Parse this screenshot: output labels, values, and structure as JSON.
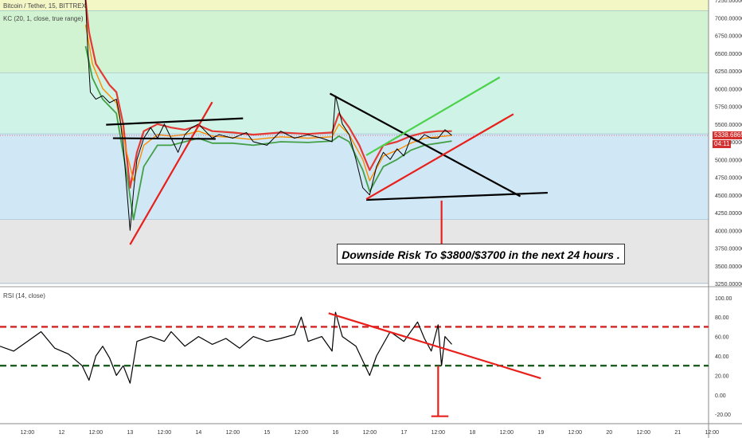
{
  "header": {
    "symbol_line": "Bitcoin / Tether, 15, BITTREX",
    "indicator_line": "KC (20, 1, close, true range)",
    "rsi_line": "RSI (14, close)"
  },
  "current_price_label": "5338.68652",
  "countdown_label": "04:11",
  "annotation": "Downside Risk To  $3800/$3700 in the next 24 hours .",
  "colors": {
    "price_line": "#000000",
    "kc_red": "#e53935",
    "kc_orange": "#fb8c00",
    "kc_green": "#43a047",
    "trend_red": "#e8201c",
    "trend_green": "#4cd14c",
    "rsi_overbought": "#d32f2f",
    "rsi_oversold": "#1b5e20"
  },
  "chart_data": [
    {
      "type": "line",
      "title": "Bitcoin / Tether, 15, BITTREX",
      "ylim": [
        3250,
        7250
      ],
      "y_ticks": [
        "7250.00000",
        "7000.00000",
        "6750.00000",
        "6500.00000",
        "6250.00000",
        "6000.00000",
        "5750.00000",
        "5500.00000",
        "5250.00000",
        "5000.00000",
        "4750.00000",
        "4500.00000",
        "4250.00000",
        "4000.00000",
        "3750.00000",
        "3500.00000",
        "3250.00000"
      ],
      "x_ticks": [
        "12:00",
        "12",
        "12:00",
        "13",
        "12:00",
        "14",
        "12:00",
        "15",
        "12:00",
        "16",
        "12:00",
        "17",
        "12:00",
        "18",
        "12:00",
        "19",
        "12:00",
        "20",
        "12:00",
        "21",
        "12:00"
      ],
      "x_tick_pos": [
        0.5,
        1,
        1.5,
        2,
        2.5,
        3,
        3.5,
        4,
        4.5,
        5,
        5.5,
        6,
        6.5,
        7,
        7.5,
        8,
        8.5,
        9,
        9.5,
        10,
        10.5
      ],
      "xlim": [
        0.1,
        10.45
      ],
      "zones": [
        {
          "from": 7100,
          "to": 7250,
          "color": "#f3f7c6"
        },
        {
          "from": 6220,
          "to": 7100,
          "color": "#d2f3d2"
        },
        {
          "from": 5360,
          "to": 6220,
          "color": "#cff3e6"
        },
        {
          "from": 4150,
          "to": 5360,
          "color": "#d0e8f5"
        },
        {
          "from": 3250,
          "to": 4150,
          "color": "#e6e6e6"
        }
      ],
      "series": [
        {
          "type": "price",
          "values": [
            [
              1.35,
              7250
            ],
            [
              1.38,
              6600
            ],
            [
              1.42,
              5950
            ],
            [
              1.5,
              5850
            ],
            [
              1.6,
              5900
            ],
            [
              1.7,
              5800
            ],
            [
              1.8,
              5850
            ],
            [
              1.85,
              5600
            ],
            [
              1.9,
              5200
            ],
            [
              1.95,
              4600
            ],
            [
              2.0,
              4000
            ],
            [
              2.05,
              4550
            ],
            [
              2.1,
              5000
            ],
            [
              2.2,
              5300
            ],
            [
              2.3,
              5450
            ],
            [
              2.4,
              5300
            ],
            [
              2.5,
              5500
            ],
            [
              2.6,
              5300
            ],
            [
              2.7,
              5100
            ],
            [
              2.8,
              5350
            ],
            [
              2.9,
              5450
            ],
            [
              3.0,
              5500
            ],
            [
              3.1,
              5400
            ],
            [
              3.2,
              5300
            ],
            [
              3.3,
              5350
            ],
            [
              3.5,
              5300
            ],
            [
              3.7,
              5380
            ],
            [
              3.8,
              5250
            ],
            [
              4.0,
              5200
            ],
            [
              4.2,
              5400
            ],
            [
              4.4,
              5300
            ],
            [
              4.6,
              5350
            ],
            [
              4.8,
              5300
            ],
            [
              4.95,
              5250
            ],
            [
              5.0,
              5900
            ],
            [
              5.1,
              5500
            ],
            [
              5.2,
              5350
            ],
            [
              5.3,
              5000
            ],
            [
              5.4,
              4600
            ],
            [
              5.5,
              4500
            ],
            [
              5.6,
              4900
            ],
            [
              5.7,
              5100
            ],
            [
              5.8,
              5000
            ],
            [
              5.9,
              5150
            ],
            [
              6.0,
              5050
            ],
            [
              6.1,
              5300
            ],
            [
              6.2,
              5250
            ],
            [
              6.3,
              5350
            ],
            [
              6.4,
              5300
            ],
            [
              6.5,
              5300
            ],
            [
              6.6,
              5420
            ],
            [
              6.7,
              5340
            ]
          ]
        },
        {
          "type": "kc_red",
          "values": [
            [
              1.35,
              7250
            ],
            [
              1.4,
              6800
            ],
            [
              1.5,
              6350
            ],
            [
              1.6,
              6200
            ],
            [
              1.7,
              6050
            ],
            [
              1.8,
              5950
            ],
            [
              1.9,
              5500
            ],
            [
              2.0,
              4600
            ],
            [
              2.1,
              5100
            ],
            [
              2.2,
              5400
            ],
            [
              2.4,
              5500
            ],
            [
              2.6,
              5450
            ],
            [
              2.8,
              5420
            ],
            [
              3.0,
              5480
            ],
            [
              3.2,
              5400
            ],
            [
              3.5,
              5380
            ],
            [
              3.8,
              5350
            ],
            [
              4.2,
              5380
            ],
            [
              4.6,
              5360
            ],
            [
              4.95,
              5380
            ],
            [
              5.05,
              5650
            ],
            [
              5.2,
              5450
            ],
            [
              5.35,
              5200
            ],
            [
              5.5,
              4850
            ],
            [
              5.7,
              5200
            ],
            [
              5.9,
              5250
            ],
            [
              6.1,
              5330
            ],
            [
              6.3,
              5380
            ],
            [
              6.5,
              5400
            ],
            [
              6.7,
              5400
            ]
          ]
        },
        {
          "type": "kc_orange",
          "values": [
            [
              1.35,
              6900
            ],
            [
              1.45,
              6350
            ],
            [
              1.6,
              6000
            ],
            [
              1.8,
              5800
            ],
            [
              1.95,
              5100
            ],
            [
              2.05,
              4700
            ],
            [
              2.2,
              5200
            ],
            [
              2.4,
              5350
            ],
            [
              2.6,
              5330
            ],
            [
              2.8,
              5350
            ],
            [
              3.0,
              5400
            ],
            [
              3.2,
              5330
            ],
            [
              3.5,
              5310
            ],
            [
              3.8,
              5280
            ],
            [
              4.2,
              5320
            ],
            [
              4.6,
              5300
            ],
            [
              4.95,
              5320
            ],
            [
              5.05,
              5500
            ],
            [
              5.2,
              5350
            ],
            [
              5.4,
              5000
            ],
            [
              5.5,
              4700
            ],
            [
              5.7,
              5050
            ],
            [
              5.9,
              5130
            ],
            [
              6.1,
              5230
            ],
            [
              6.3,
              5300
            ],
            [
              6.5,
              5320
            ],
            [
              6.7,
              5340
            ]
          ]
        },
        {
          "type": "kc_green",
          "values": [
            [
              1.35,
              6600
            ],
            [
              1.45,
              6150
            ],
            [
              1.6,
              5850
            ],
            [
              1.8,
              5650
            ],
            [
              1.95,
              4800
            ],
            [
              2.05,
              4150
            ],
            [
              2.2,
              4900
            ],
            [
              2.4,
              5200
            ],
            [
              2.6,
              5200
            ],
            [
              2.8,
              5250
            ],
            [
              3.0,
              5300
            ],
            [
              3.2,
              5230
            ],
            [
              3.5,
              5230
            ],
            [
              3.8,
              5200
            ],
            [
              4.2,
              5250
            ],
            [
              4.6,
              5240
            ],
            [
              4.95,
              5260
            ],
            [
              5.05,
              5330
            ],
            [
              5.2,
              5250
            ],
            [
              5.4,
              4850
            ],
            [
              5.5,
              4550
            ],
            [
              5.7,
              4900
            ],
            [
              5.9,
              5000
            ],
            [
              6.1,
              5130
            ],
            [
              6.3,
              5200
            ],
            [
              6.5,
              5230
            ],
            [
              6.7,
              5260
            ]
          ]
        }
      ],
      "trendlines": [
        {
          "color": "#e8201c",
          "from": [
            2.0,
            3800
          ],
          "to": [
            3.2,
            5810
          ]
        },
        {
          "color": "#000000",
          "from": [
            1.65,
            5490
          ],
          "to": [
            3.65,
            5580
          ]
        },
        {
          "color": "#000000",
          "from": [
            1.75,
            5300
          ],
          "to": [
            3.25,
            5290
          ]
        },
        {
          "color": "#000000",
          "from": [
            4.92,
            5930
          ],
          "to": [
            7.7,
            4480
          ]
        },
        {
          "color": "#000000",
          "from": [
            5.45,
            4430
          ],
          "to": [
            8.1,
            4530
          ]
        },
        {
          "color": "#4cd14c",
          "from": [
            5.45,
            5060
          ],
          "to": [
            7.4,
            6160
          ]
        },
        {
          "color": "#e8201c",
          "from": [
            5.45,
            4440
          ],
          "to": [
            7.6,
            5640
          ]
        },
        {
          "color": "#e8201c",
          "from": [
            6.55,
            4420
          ],
          "to": [
            6.55,
            3800
          ]
        }
      ]
    },
    {
      "type": "line",
      "title": "RSI (14, close)",
      "ylim": [
        -28,
        108
      ],
      "y_ticks": [
        "100.00",
        "80.00",
        "60.00",
        "40.00",
        "20.00",
        "0.00",
        "-20.00"
      ],
      "xlim": [
        0.1,
        10.45
      ],
      "levels": [
        {
          "value": 70,
          "color": "#d32f2f"
        },
        {
          "value": 30,
          "color": "#1b5e20"
        }
      ],
      "series": [
        {
          "type": "rsi",
          "values": [
            [
              0.1,
              50
            ],
            [
              0.3,
              45
            ],
            [
              0.5,
              55
            ],
            [
              0.7,
              65
            ],
            [
              0.9,
              48
            ],
            [
              1.1,
              42
            ],
            [
              1.3,
              30
            ],
            [
              1.4,
              15
            ],
            [
              1.5,
              40
            ],
            [
              1.6,
              50
            ],
            [
              1.7,
              38
            ],
            [
              1.8,
              20
            ],
            [
              1.9,
              30
            ],
            [
              2.0,
              12
            ],
            [
              2.1,
              55
            ],
            [
              2.3,
              60
            ],
            [
              2.5,
              55
            ],
            [
              2.6,
              65
            ],
            [
              2.8,
              50
            ],
            [
              3.0,
              60
            ],
            [
              3.2,
              52
            ],
            [
              3.4,
              58
            ],
            [
              3.6,
              48
            ],
            [
              3.8,
              60
            ],
            [
              4.0,
              55
            ],
            [
              4.2,
              58
            ],
            [
              4.4,
              62
            ],
            [
              4.5,
              80
            ],
            [
              4.6,
              55
            ],
            [
              4.8,
              60
            ],
            [
              4.95,
              45
            ],
            [
              5.0,
              85
            ],
            [
              5.1,
              60
            ],
            [
              5.3,
              50
            ],
            [
              5.5,
              20
            ],
            [
              5.6,
              40
            ],
            [
              5.8,
              65
            ],
            [
              6.0,
              55
            ],
            [
              6.2,
              75
            ],
            [
              6.3,
              58
            ],
            [
              6.4,
              45
            ],
            [
              6.5,
              72
            ],
            [
              6.55,
              30
            ],
            [
              6.6,
              60
            ],
            [
              6.7,
              52
            ]
          ]
        }
      ],
      "trendlines": [
        {
          "color": "#e8201c",
          "from": [
            4.9,
            84
          ],
          "to": [
            8.0,
            17
          ]
        },
        {
          "color": "#e8201c",
          "from": [
            6.5,
            30
          ],
          "to": [
            6.5,
            -22
          ]
        },
        {
          "color": "#e8201c",
          "from": [
            6.4,
            -22
          ],
          "to": [
            6.65,
            -22
          ]
        }
      ]
    }
  ]
}
